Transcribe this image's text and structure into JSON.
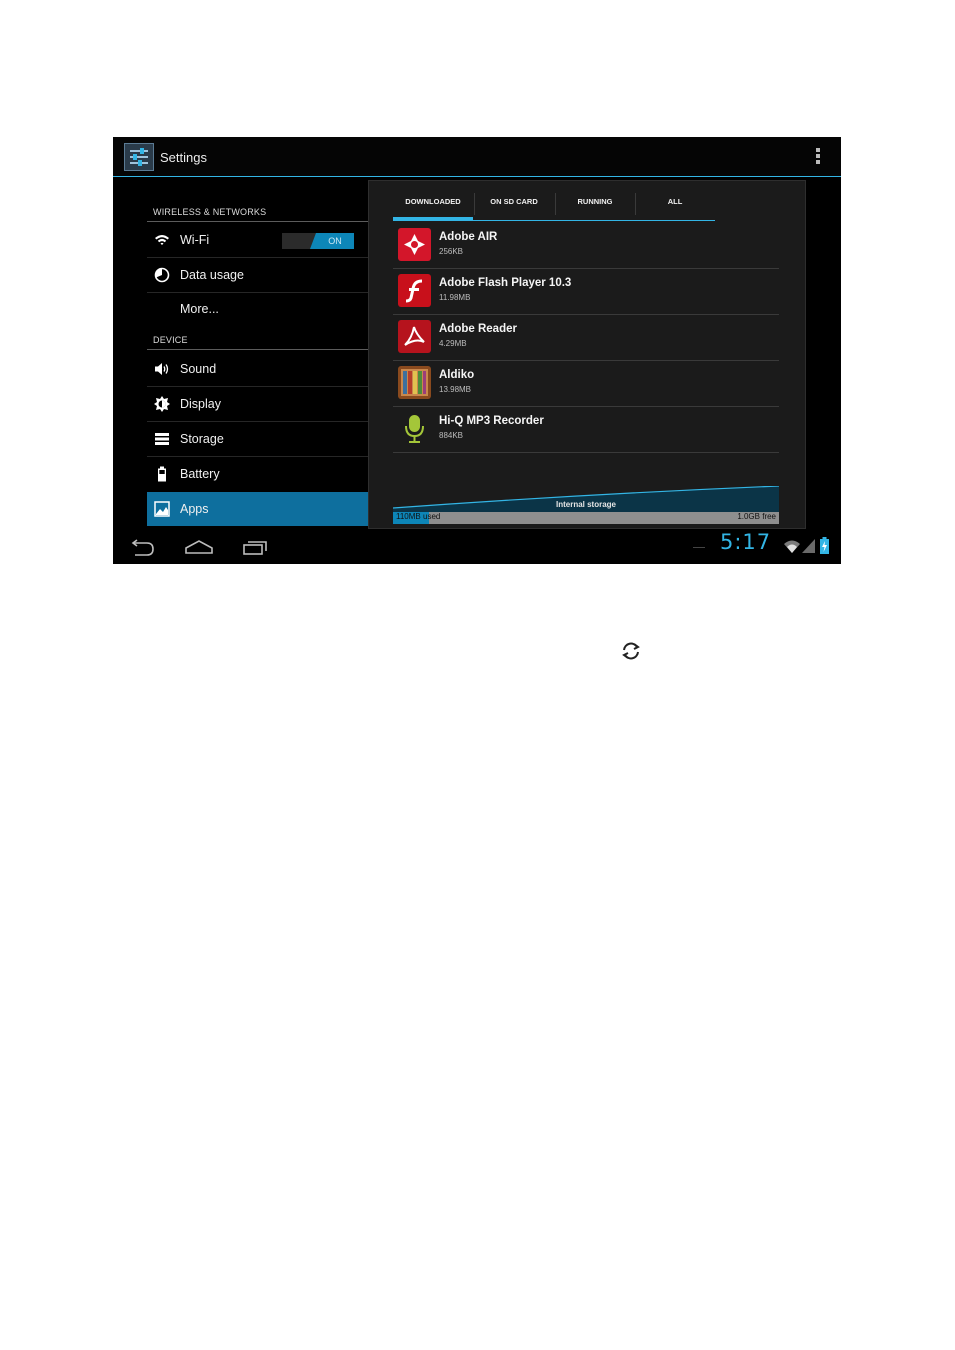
{
  "window": {
    "title": "Settings"
  },
  "sidebar": {
    "sections": [
      {
        "label": "WIRELESS & NETWORKS"
      },
      {
        "label": "DEVICE"
      }
    ],
    "items": [
      {
        "label": "Wi-Fi",
        "icon": "wifi-icon",
        "toggle": "ON"
      },
      {
        "label": "Data usage",
        "icon": "data-usage-icon"
      },
      {
        "label": "More..."
      },
      {
        "label": "Sound",
        "icon": "sound-icon"
      },
      {
        "label": "Display",
        "icon": "display-icon"
      },
      {
        "label": "Storage",
        "icon": "storage-icon"
      },
      {
        "label": "Battery",
        "icon": "battery-icon"
      },
      {
        "label": "Apps",
        "icon": "apps-icon",
        "selected": true
      }
    ]
  },
  "tabs": [
    {
      "label": "DOWNLOADED",
      "selected": true
    },
    {
      "label": "ON SD CARD"
    },
    {
      "label": "RUNNING"
    },
    {
      "label": "ALL"
    }
  ],
  "apps": [
    {
      "name": "Adobe AIR",
      "size": "256KB",
      "icon": "adobe-air-icon"
    },
    {
      "name": "Adobe Flash Player 10.3",
      "size": "11.98MB",
      "icon": "adobe-flash-icon"
    },
    {
      "name": "Adobe Reader",
      "size": "4.29MB",
      "icon": "adobe-reader-icon"
    },
    {
      "name": "Aldiko",
      "size": "13.98MB",
      "icon": "aldiko-icon"
    },
    {
      "name": "Hi-Q MP3 Recorder",
      "size": "884KB",
      "icon": "microphone-icon"
    }
  ],
  "storage": {
    "title": "Internal storage",
    "used": "110MB",
    "used_suffix": "used",
    "free": "1.0GB free"
  },
  "statusbar": {
    "time": "5:17"
  },
  "colors": {
    "accent": "#33b5e5",
    "selected": "#0e6f9e"
  }
}
